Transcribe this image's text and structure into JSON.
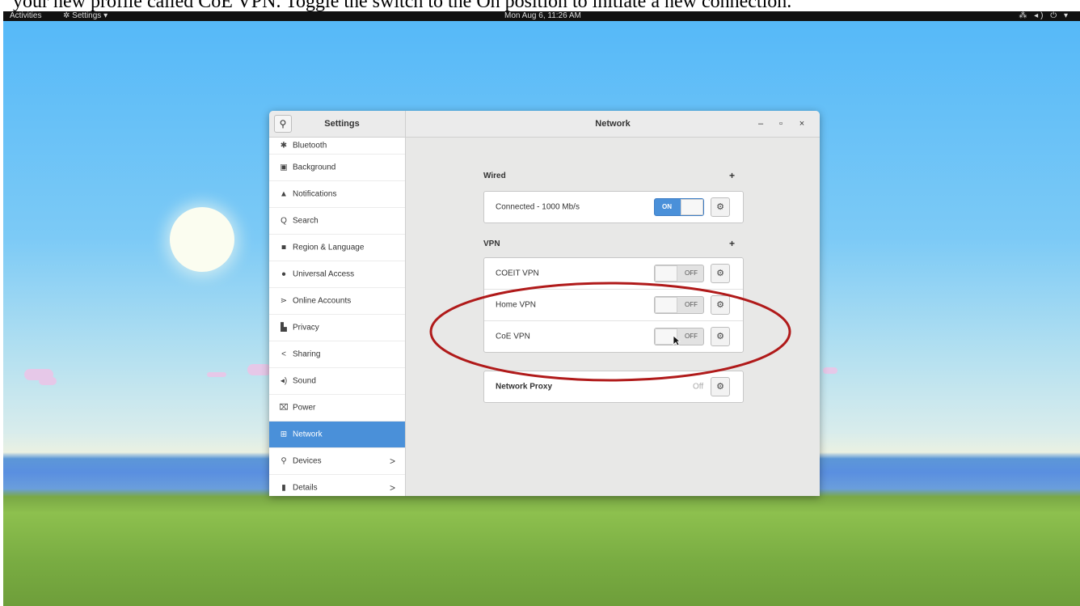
{
  "caption": "your new profile called CoE VPN. Toggle the switch to the On position to initiate a new connection.",
  "topbar": {
    "activities": "Activities",
    "app_menu": "✲ Settings ▾",
    "clock": "Mon Aug 6, 11:26 AM",
    "tray": "⁂ ◂) ⏻ ▾"
  },
  "window": {
    "sidebar_title": "Settings",
    "panel_title": "Network",
    "minimize": "–",
    "maximize": "▫",
    "close": "×"
  },
  "sidebar": {
    "items": [
      {
        "label": "Bluetooth",
        "icon": "bluetooth-icon",
        "glyph": "✱"
      },
      {
        "label": "Background",
        "icon": "background-icon",
        "glyph": "▣"
      },
      {
        "label": "Notifications",
        "icon": "bell-icon",
        "glyph": "▲"
      },
      {
        "label": "Search",
        "icon": "search-icon",
        "glyph": "Q"
      },
      {
        "label": "Region & Language",
        "icon": "flag-icon",
        "glyph": "■"
      },
      {
        "label": "Universal Access",
        "icon": "accessibility-icon",
        "glyph": "●"
      },
      {
        "label": "Online Accounts",
        "icon": "online-accounts-icon",
        "glyph": "⋗"
      },
      {
        "label": "Privacy",
        "icon": "privacy-icon",
        "glyph": "▙"
      },
      {
        "label": "Sharing",
        "icon": "share-icon",
        "glyph": "<"
      },
      {
        "label": "Sound",
        "icon": "speaker-icon",
        "glyph": "◂)"
      },
      {
        "label": "Power",
        "icon": "power-icon",
        "glyph": "⌧"
      },
      {
        "label": "Network",
        "icon": "network-icon",
        "glyph": "⊞"
      },
      {
        "label": "Devices",
        "icon": "devices-icon",
        "glyph": "⚲",
        "arrow": ">"
      },
      {
        "label": "Details",
        "icon": "details-icon",
        "glyph": "▮",
        "arrow": ">"
      }
    ],
    "selected": "Network"
  },
  "network": {
    "wired_heading": "Wired",
    "wired_connection": "Connected - 1000 Mb/s",
    "wired_switch": "ON",
    "vpn_heading": "VPN",
    "add_symbol": "+",
    "gear_glyph": "⚙",
    "vpn_connections": [
      {
        "name": "COEIT VPN",
        "state": "OFF"
      },
      {
        "name": "Home VPN",
        "state": "OFF"
      },
      {
        "name": "CoE VPN",
        "state": "OFF"
      }
    ],
    "proxy_label": "Network Proxy",
    "proxy_state": "Off"
  },
  "colors": {
    "accent": "#4a90d9",
    "annotation": "#b01a1a"
  }
}
